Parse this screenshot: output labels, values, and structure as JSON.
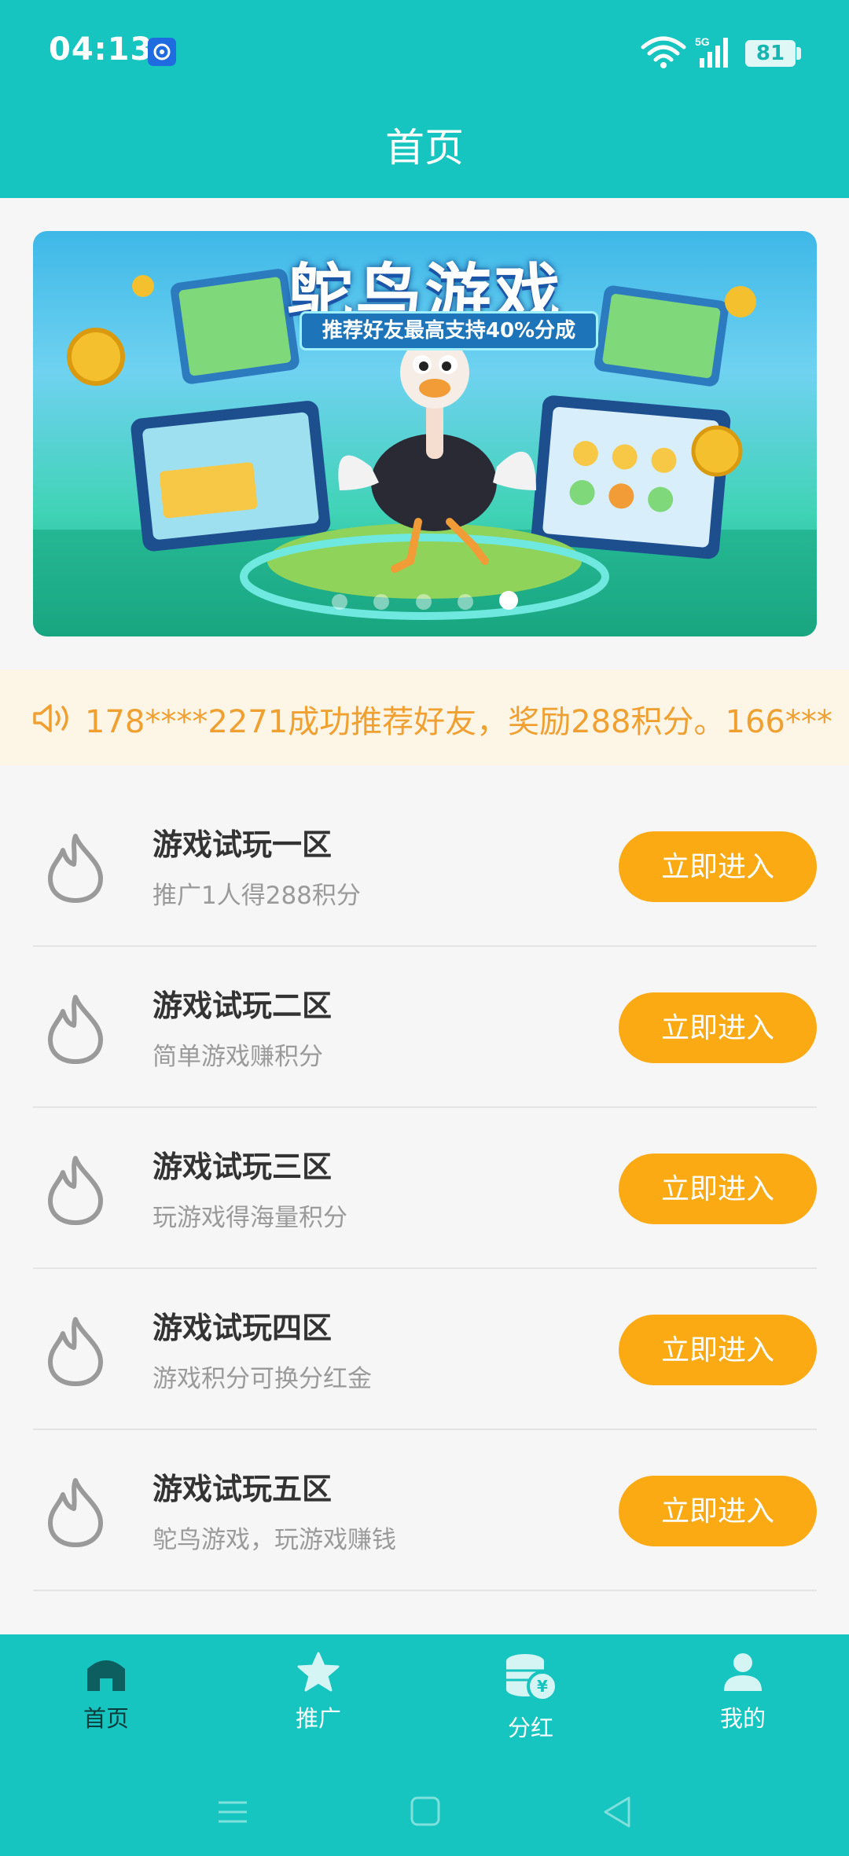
{
  "status_bar": {
    "time": "04:13",
    "battery": "81",
    "network": "5G"
  },
  "header": {
    "title": "首页"
  },
  "banner": {
    "title": "鸵鸟游戏",
    "subtitle": "推荐好友最高支持40%分成",
    "dot_count": 5,
    "active_dot": 4
  },
  "notice": {
    "text": "178****2271成功推荐好友，奖励288积分。166***"
  },
  "zones": [
    {
      "title": "游戏试玩一区",
      "desc": "推广1人得288积分",
      "button": "立即进入"
    },
    {
      "title": "游戏试玩二区",
      "desc": "简单游戏赚积分",
      "button": "立即进入"
    },
    {
      "title": "游戏试玩三区",
      "desc": "玩游戏得海量积分",
      "button": "立即进入"
    },
    {
      "title": "游戏试玩四区",
      "desc": "游戏积分可换分红金",
      "button": "立即进入"
    },
    {
      "title": "游戏试玩五区",
      "desc": "鸵鸟游戏，玩游戏赚钱",
      "button": "立即进入"
    }
  ],
  "bottom_nav": {
    "items": [
      {
        "label": "首页",
        "icon": "home-icon",
        "active": true
      },
      {
        "label": "推广",
        "icon": "star-icon",
        "active": false
      },
      {
        "label": "分红",
        "icon": "coins-icon",
        "active": false
      },
      {
        "label": "我的",
        "icon": "user-icon",
        "active": false
      }
    ]
  },
  "colors": {
    "primary": "#16c4c0",
    "button": "#fbaa13",
    "notice_bg": "#fdf5e6",
    "notice_text": "#f0a030"
  }
}
